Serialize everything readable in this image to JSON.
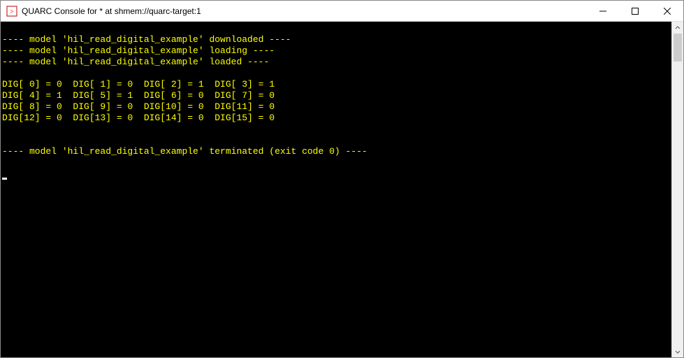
{
  "window": {
    "title": "QUARC Console for * at shmem://quarc-target:1"
  },
  "console": {
    "lines": [
      "",
      "---- model 'hil_read_digital_example' downloaded ----",
      "---- model 'hil_read_digital_example' loading ----",
      "---- model 'hil_read_digital_example' loaded ----",
      "",
      "DIG[ 0] = 0  DIG[ 1] = 0  DIG[ 2] = 1  DIG[ 3] = 1",
      "DIG[ 4] = 1  DIG[ 5] = 1  DIG[ 6] = 0  DIG[ 7] = 0",
      "DIG[ 8] = 0  DIG[ 9] = 0  DIG[10] = 0  DIG[11] = 0",
      "DIG[12] = 0  DIG[13] = 0  DIG[14] = 0  DIG[15] = 0",
      "",
      "",
      "---- model 'hil_read_digital_example' terminated (exit code 0) ----",
      ""
    ]
  }
}
